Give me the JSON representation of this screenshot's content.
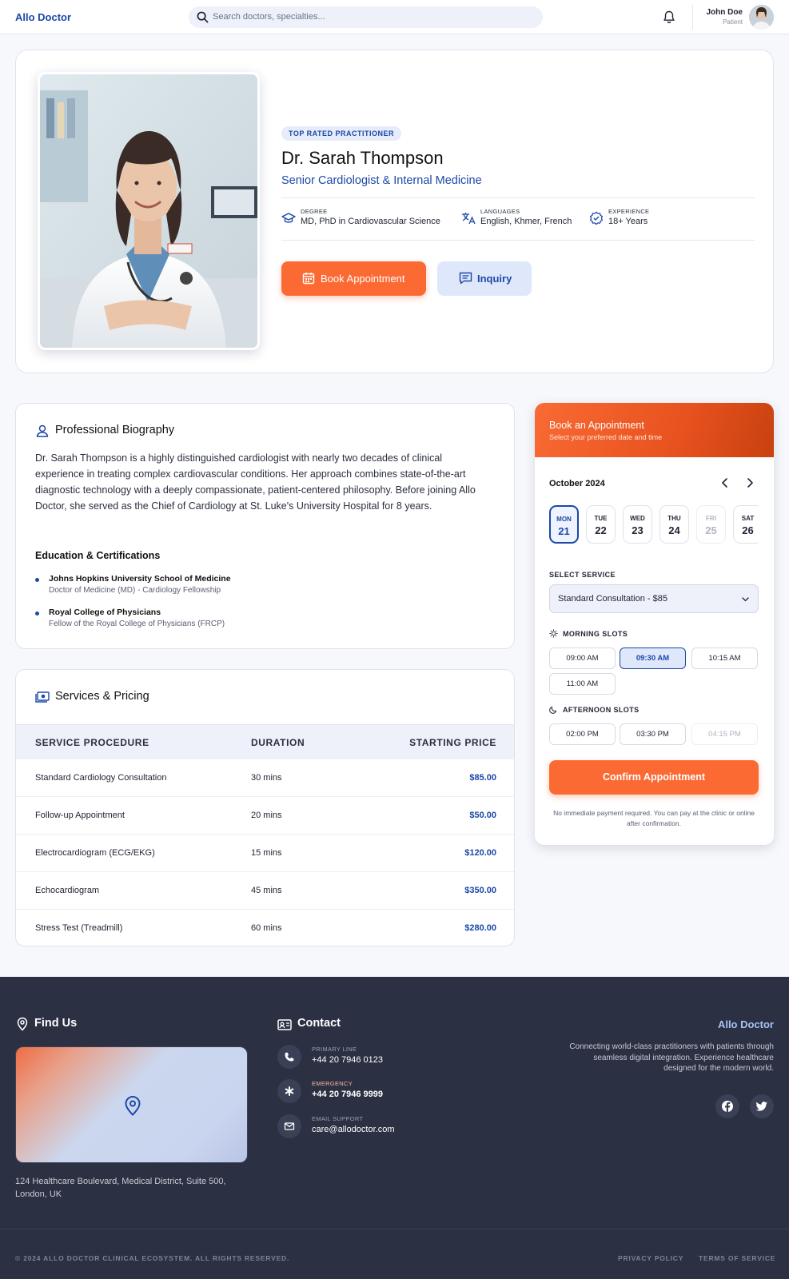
{
  "header": {
    "logo": "Allo Doctor",
    "search_placeholder": "Search doctors, specialties...",
    "user_name": "John Doe",
    "user_role": "Patient"
  },
  "profile": {
    "badge": "TOP RATED PRACTITIONER",
    "name": "Dr. Sarah Thompson",
    "specialty": "Senior Cardiologist & Internal Medicine",
    "meta": [
      {
        "label": "DEGREE",
        "value": "MD, PhD in Cardiovascular Science",
        "icon": "graduation-cap-icon"
      },
      {
        "label": "LANGUAGES",
        "value": "English, Khmer, French",
        "icon": "translate-icon"
      },
      {
        "label": "EXPERIENCE",
        "value": "18+ Years",
        "icon": "verified-badge-icon"
      }
    ],
    "book_label": "Book Appointment",
    "inquiry_label": "Inquiry"
  },
  "bio": {
    "title": "Professional Biography",
    "text": "Dr. Sarah Thompson is a highly distinguished cardiologist with nearly two decades of clinical experience in treating complex cardiovascular conditions. Her approach combines state-of-the-art diagnostic technology with a deeply compassionate, patient-centered philosophy. Before joining Allo Doctor, she served as the Chief of Cardiology at St. Luke's University Hospital for 8 years.",
    "edu_title": "Education & Certifications",
    "education": [
      {
        "name": "Johns Hopkins University School of Medicine",
        "desc": "Doctor of Medicine (MD) - Cardiology Fellowship"
      },
      {
        "name": "Royal College of Physicians",
        "desc": "Fellow of the Royal College of Physicians (FRCP)"
      }
    ]
  },
  "services": {
    "title": "Services & Pricing",
    "headers": [
      "SERVICE PROCEDURE",
      "DURATION",
      "STARTING PRICE"
    ],
    "rows": [
      {
        "name": "Standard Cardiology Consultation",
        "duration": "30 mins",
        "price": "$85.00"
      },
      {
        "name": "Follow-up Appointment",
        "duration": "20 mins",
        "price": "$50.00"
      },
      {
        "name": "Electrocardiogram (ECG/EKG)",
        "duration": "15 mins",
        "price": "$120.00"
      },
      {
        "name": "Echocardiogram",
        "duration": "45 mins",
        "price": "$350.00"
      },
      {
        "name": "Stress Test (Treadmill)",
        "duration": "60 mins",
        "price": "$280.00"
      }
    ]
  },
  "booking": {
    "title": "Book an Appointment",
    "subtitle": "Select your preferred date and time",
    "month": "October 2024",
    "days": [
      {
        "dow": "MON",
        "num": "21",
        "state": "active"
      },
      {
        "dow": "TUE",
        "num": "22",
        "state": "normal"
      },
      {
        "dow": "WED",
        "num": "23",
        "state": "normal"
      },
      {
        "dow": "THU",
        "num": "24",
        "state": "normal"
      },
      {
        "dow": "FRI",
        "num": "25",
        "state": "muted"
      },
      {
        "dow": "SAT",
        "num": "26",
        "state": "normal"
      }
    ],
    "service_label": "SELECT SERVICE",
    "service_value": "Standard Consultation - $85",
    "morning_label": "MORNING SLOTS",
    "morning": [
      {
        "time": "09:00 AM",
        "state": "normal"
      },
      {
        "time": "09:30 AM",
        "state": "active"
      },
      {
        "time": "10:15 AM",
        "state": "normal"
      },
      {
        "time": "11:00 AM",
        "state": "normal"
      }
    ],
    "afternoon_label": "AFTERNOON SLOTS",
    "afternoon": [
      {
        "time": "02:00 PM",
        "state": "normal"
      },
      {
        "time": "03:30 PM",
        "state": "normal"
      },
      {
        "time": "04:15 PM",
        "state": "disabled"
      }
    ],
    "confirm_label": "Confirm Appointment",
    "note": "No immediate payment required. You can pay at the clinic or online after confirmation."
  },
  "footer": {
    "find_title": "Find Us",
    "address": "124 Healthcare Boulevard, Medical District, Suite 500, London, UK",
    "contact_title": "Contact",
    "contacts": [
      {
        "label": "PRIMARY LINE",
        "value": "+44 20 7946 0123",
        "icon": "phone-icon"
      },
      {
        "label": "EMERGENCY",
        "value": "+44 20 7946 9999",
        "icon": "asterisk-icon"
      },
      {
        "label": "EMAIL SUPPORT",
        "value": "care@allodoctor.com",
        "icon": "mail-icon"
      }
    ],
    "brand": "Allo Doctor",
    "description": "Connecting world-class practitioners with patients through seamless digital integration. Experience healthcare designed for the modern world.",
    "copyright": "© 2024 ALLO DOCTOR CLINICAL ECOSYSTEM. ALL RIGHTS RESERVED.",
    "privacy": "PRIVACY POLICY",
    "terms": "TERMS OF SERVICE"
  },
  "colors": {
    "brand_blue": "#1c48a8",
    "accent_orange": "#fb6a33",
    "footer_bg": "#2b3042"
  }
}
